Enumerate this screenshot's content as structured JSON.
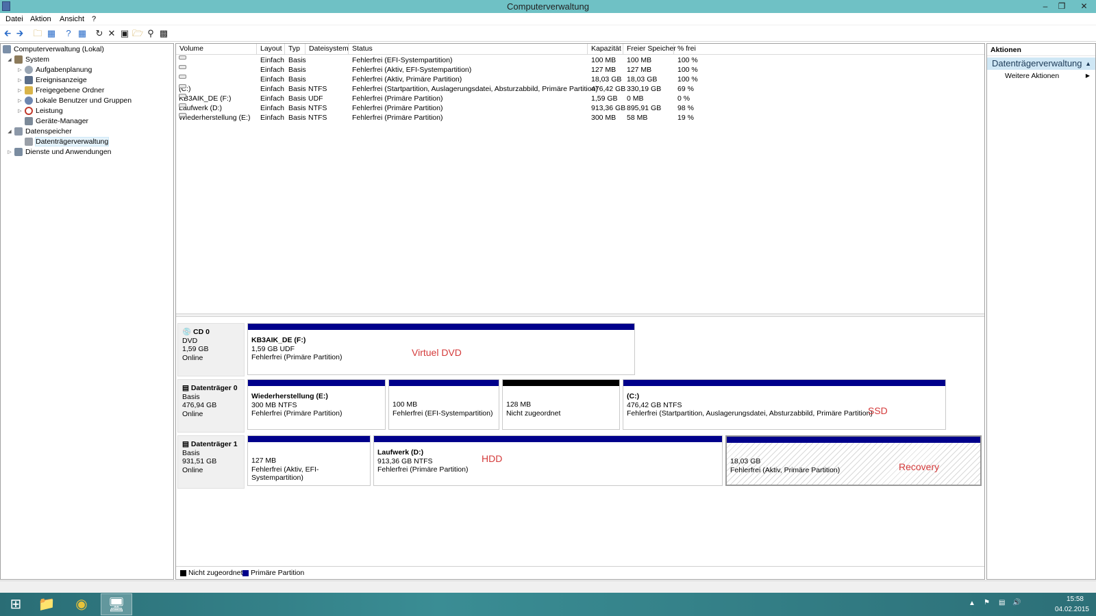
{
  "window": {
    "title": "Computerverwaltung"
  },
  "menu": [
    "Datei",
    "Aktion",
    "Ansicht",
    "?"
  ],
  "toolbar": {
    "icons": [
      "back-arrow",
      "forward-arrow",
      "up-folder",
      "show-hide-tree",
      "help",
      "properties-view",
      "refresh",
      "delete",
      "properties",
      "open",
      "search",
      "disk-settings"
    ]
  },
  "tree": {
    "root": "Computerverwaltung (Lokal)",
    "system": "System",
    "system_children": [
      "Aufgabenplanung",
      "Ereignisanzeige",
      "Freigegebene Ordner",
      "Lokale Benutzer und Gruppen",
      "Leistung",
      "Geräte-Manager"
    ],
    "storage": "Datenspeicher",
    "storage_children": [
      "Datenträgerverwaltung"
    ],
    "services": "Dienste und Anwendungen"
  },
  "volumes": {
    "columns": [
      "Volume",
      "Layout",
      "Typ",
      "Dateisystem",
      "Status",
      "Kapazität",
      "Freier Speicher",
      "% frei"
    ],
    "rows": [
      {
        "volume": "",
        "layout": "Einfach",
        "typ": "Basis",
        "fs": "",
        "status": "Fehlerfrei (EFI-Systempartition)",
        "cap": "100 MB",
        "free": "100 MB",
        "pct": "100 %"
      },
      {
        "volume": "",
        "layout": "Einfach",
        "typ": "Basis",
        "fs": "",
        "status": "Fehlerfrei (Aktiv, EFI-Systempartition)",
        "cap": "127 MB",
        "free": "127 MB",
        "pct": "100 %"
      },
      {
        "volume": "",
        "layout": "Einfach",
        "typ": "Basis",
        "fs": "",
        "status": "Fehlerfrei (Aktiv, Primäre Partition)",
        "cap": "18,03 GB",
        "free": "18,03 GB",
        "pct": "100 %"
      },
      {
        "volume": "(C:)",
        "layout": "Einfach",
        "typ": "Basis",
        "fs": "NTFS",
        "status": "Fehlerfrei (Startpartition, Auslagerungsdatei, Absturzabbild, Primäre Partition)",
        "cap": "476,42 GB",
        "free": "330,19 GB",
        "pct": "69 %"
      },
      {
        "volume": "KB3AIK_DE (F:)",
        "layout": "Einfach",
        "typ": "Basis",
        "fs": "UDF",
        "status": "Fehlerfrei (Primäre Partition)",
        "cap": "1,59 GB",
        "free": "0 MB",
        "pct": "0 %"
      },
      {
        "volume": "Laufwerk (D:)",
        "layout": "Einfach",
        "typ": "Basis",
        "fs": "NTFS",
        "status": "Fehlerfrei (Primäre Partition)",
        "cap": "913,36 GB",
        "free": "895,91 GB",
        "pct": "98 %"
      },
      {
        "volume": "Wiederherstellung (E:)",
        "layout": "Einfach",
        "typ": "Basis",
        "fs": "NTFS",
        "status": "Fehlerfrei (Primäre Partition)",
        "cap": "300 MB",
        "free": "58 MB",
        "pct": "19 %"
      }
    ]
  },
  "disks": {
    "cd0": {
      "name": "CD 0",
      "type": "DVD",
      "size": "1,59 GB",
      "state": "Online",
      "p1": {
        "title": "KB3AIK_DE  (F:)",
        "l2": "1,59 GB UDF",
        "l3": "Fehlerfrei (Primäre Partition)"
      },
      "annotation": "Virtuel DVD"
    },
    "d0": {
      "name": "Datenträger 0",
      "type": "Basis",
      "size": "476,94 GB",
      "state": "Online",
      "p1": {
        "title": "Wiederherstellung  (E:)",
        "l2": "300 MB NTFS",
        "l3": "Fehlerfrei (Primäre Partition)"
      },
      "p2": {
        "l2": "100 MB",
        "l3": "Fehlerfrei (EFI-Systempartition)"
      },
      "p3": {
        "l2": "128 MB",
        "l3": "Nicht zugeordnet"
      },
      "p4": {
        "title": "(C:)",
        "l2": "476,42 GB NTFS",
        "l3": "Fehlerfrei (Startpartition, Auslagerungsdatei, Absturzabbild, Primäre Partition)"
      },
      "annotation": "SSD"
    },
    "d1": {
      "name": "Datenträger 1",
      "type": "Basis",
      "size": "931,51 GB",
      "state": "Online",
      "p1": {
        "l2": "127 MB",
        "l3": "Fehlerfrei (Aktiv, EFI-Systempartition)"
      },
      "p2": {
        "title": "Laufwerk  (D:)",
        "l2": "913,36 GB NTFS",
        "l3": "Fehlerfrei (Primäre Partition)"
      },
      "p3": {
        "l2": "18,03 GB",
        "l3": "Fehlerfrei (Aktiv, Primäre Partition)"
      },
      "annotation_hdd": "HDD",
      "annotation_recovery": "Recovery"
    }
  },
  "legend": {
    "unallocated": "Nicht zugeordnet",
    "primary": "Primäre Partition",
    "colors": {
      "unallocated": "#000000",
      "primary": "#00008b"
    }
  },
  "actions": {
    "header": "Aktionen",
    "section": "Datenträgerverwaltung",
    "more": "Weitere Aktionen"
  },
  "taskbar": {
    "time": "15:58",
    "date": "04.02.2015",
    "apps": [
      "start-icon",
      "file-explorer-icon",
      "chrome-icon",
      "computer-management-icon"
    ]
  }
}
